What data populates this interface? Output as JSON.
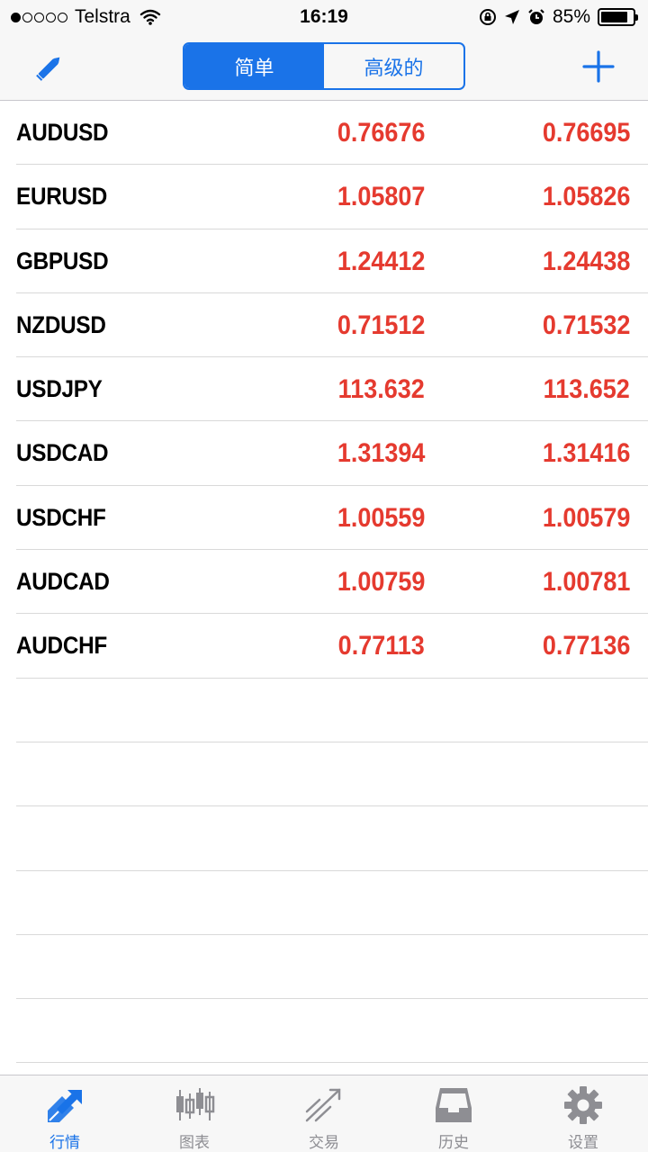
{
  "status_bar": {
    "carrier": "Telstra",
    "time": "16:19",
    "battery": "85%",
    "battery_level": 0.85
  },
  "nav": {
    "segments": [
      {
        "label": "简单",
        "active": true
      },
      {
        "label": "高级的",
        "active": false
      }
    ]
  },
  "quotes": [
    {
      "symbol": "AUDUSD",
      "bid": "0.76676",
      "ask": "0.76695"
    },
    {
      "symbol": "EURUSD",
      "bid": "1.05807",
      "ask": "1.05826"
    },
    {
      "symbol": "GBPUSD",
      "bid": "1.24412",
      "ask": "1.24438"
    },
    {
      "symbol": "NZDUSD",
      "bid": "0.71512",
      "ask": "0.71532"
    },
    {
      "symbol": "USDJPY",
      "bid": "113.632",
      "ask": "113.652"
    },
    {
      "symbol": "USDCAD",
      "bid": "1.31394",
      "ask": "1.31416"
    },
    {
      "symbol": "USDCHF",
      "bid": "1.00559",
      "ask": "1.00579"
    },
    {
      "symbol": "AUDCAD",
      "bid": "1.00759",
      "ask": "1.00781"
    },
    {
      "symbol": "AUDCHF",
      "bid": "0.77113",
      "ask": "0.77136"
    }
  ],
  "tabs": [
    {
      "label": "行情",
      "icon": "quotes-icon",
      "active": true
    },
    {
      "label": "图表",
      "icon": "chart-icon",
      "active": false
    },
    {
      "label": "交易",
      "icon": "trade-icon",
      "active": false
    },
    {
      "label": "历史",
      "icon": "history-icon",
      "active": false
    },
    {
      "label": "设置",
      "icon": "gear-icon",
      "active": false
    }
  ],
  "colors": {
    "accent": "#1a73e8",
    "price": "#e53a2f",
    "inactive_tab": "#8e8e93"
  }
}
